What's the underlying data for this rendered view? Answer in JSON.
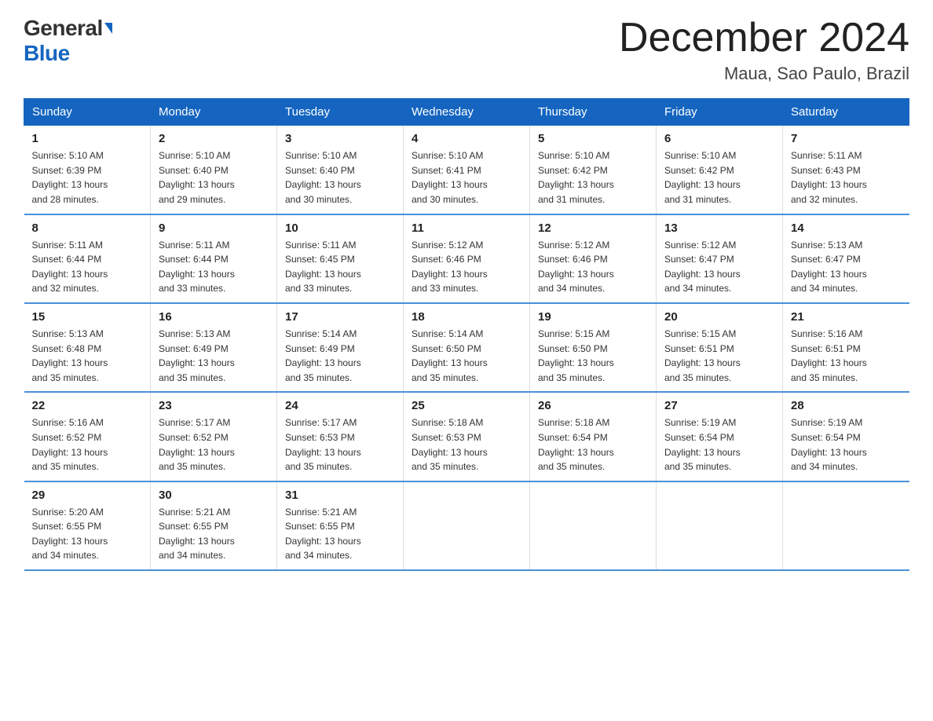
{
  "header": {
    "logo_general": "General",
    "logo_blue": "Blue",
    "month_title": "December 2024",
    "location": "Maua, Sao Paulo, Brazil"
  },
  "weekdays": [
    "Sunday",
    "Monday",
    "Tuesday",
    "Wednesday",
    "Thursday",
    "Friday",
    "Saturday"
  ],
  "weeks": [
    [
      {
        "day": "1",
        "sunrise": "5:10 AM",
        "sunset": "6:39 PM",
        "daylight": "13 hours and 28 minutes."
      },
      {
        "day": "2",
        "sunrise": "5:10 AM",
        "sunset": "6:40 PM",
        "daylight": "13 hours and 29 minutes."
      },
      {
        "day": "3",
        "sunrise": "5:10 AM",
        "sunset": "6:40 PM",
        "daylight": "13 hours and 30 minutes."
      },
      {
        "day": "4",
        "sunrise": "5:10 AM",
        "sunset": "6:41 PM",
        "daylight": "13 hours and 30 minutes."
      },
      {
        "day": "5",
        "sunrise": "5:10 AM",
        "sunset": "6:42 PM",
        "daylight": "13 hours and 31 minutes."
      },
      {
        "day": "6",
        "sunrise": "5:10 AM",
        "sunset": "6:42 PM",
        "daylight": "13 hours and 31 minutes."
      },
      {
        "day": "7",
        "sunrise": "5:11 AM",
        "sunset": "6:43 PM",
        "daylight": "13 hours and 32 minutes."
      }
    ],
    [
      {
        "day": "8",
        "sunrise": "5:11 AM",
        "sunset": "6:44 PM",
        "daylight": "13 hours and 32 minutes."
      },
      {
        "day": "9",
        "sunrise": "5:11 AM",
        "sunset": "6:44 PM",
        "daylight": "13 hours and 33 minutes."
      },
      {
        "day": "10",
        "sunrise": "5:11 AM",
        "sunset": "6:45 PM",
        "daylight": "13 hours and 33 minutes."
      },
      {
        "day": "11",
        "sunrise": "5:12 AM",
        "sunset": "6:46 PM",
        "daylight": "13 hours and 33 minutes."
      },
      {
        "day": "12",
        "sunrise": "5:12 AM",
        "sunset": "6:46 PM",
        "daylight": "13 hours and 34 minutes."
      },
      {
        "day": "13",
        "sunrise": "5:12 AM",
        "sunset": "6:47 PM",
        "daylight": "13 hours and 34 minutes."
      },
      {
        "day": "14",
        "sunrise": "5:13 AM",
        "sunset": "6:47 PM",
        "daylight": "13 hours and 34 minutes."
      }
    ],
    [
      {
        "day": "15",
        "sunrise": "5:13 AM",
        "sunset": "6:48 PM",
        "daylight": "13 hours and 35 minutes."
      },
      {
        "day": "16",
        "sunrise": "5:13 AM",
        "sunset": "6:49 PM",
        "daylight": "13 hours and 35 minutes."
      },
      {
        "day": "17",
        "sunrise": "5:14 AM",
        "sunset": "6:49 PM",
        "daylight": "13 hours and 35 minutes."
      },
      {
        "day": "18",
        "sunrise": "5:14 AM",
        "sunset": "6:50 PM",
        "daylight": "13 hours and 35 minutes."
      },
      {
        "day": "19",
        "sunrise": "5:15 AM",
        "sunset": "6:50 PM",
        "daylight": "13 hours and 35 minutes."
      },
      {
        "day": "20",
        "sunrise": "5:15 AM",
        "sunset": "6:51 PM",
        "daylight": "13 hours and 35 minutes."
      },
      {
        "day": "21",
        "sunrise": "5:16 AM",
        "sunset": "6:51 PM",
        "daylight": "13 hours and 35 minutes."
      }
    ],
    [
      {
        "day": "22",
        "sunrise": "5:16 AM",
        "sunset": "6:52 PM",
        "daylight": "13 hours and 35 minutes."
      },
      {
        "day": "23",
        "sunrise": "5:17 AM",
        "sunset": "6:52 PM",
        "daylight": "13 hours and 35 minutes."
      },
      {
        "day": "24",
        "sunrise": "5:17 AM",
        "sunset": "6:53 PM",
        "daylight": "13 hours and 35 minutes."
      },
      {
        "day": "25",
        "sunrise": "5:18 AM",
        "sunset": "6:53 PM",
        "daylight": "13 hours and 35 minutes."
      },
      {
        "day": "26",
        "sunrise": "5:18 AM",
        "sunset": "6:54 PM",
        "daylight": "13 hours and 35 minutes."
      },
      {
        "day": "27",
        "sunrise": "5:19 AM",
        "sunset": "6:54 PM",
        "daylight": "13 hours and 35 minutes."
      },
      {
        "day": "28",
        "sunrise": "5:19 AM",
        "sunset": "6:54 PM",
        "daylight": "13 hours and 34 minutes."
      }
    ],
    [
      {
        "day": "29",
        "sunrise": "5:20 AM",
        "sunset": "6:55 PM",
        "daylight": "13 hours and 34 minutes."
      },
      {
        "day": "30",
        "sunrise": "5:21 AM",
        "sunset": "6:55 PM",
        "daylight": "13 hours and 34 minutes."
      },
      {
        "day": "31",
        "sunrise": "5:21 AM",
        "sunset": "6:55 PM",
        "daylight": "13 hours and 34 minutes."
      },
      null,
      null,
      null,
      null
    ]
  ],
  "labels": {
    "sunrise": "Sunrise:",
    "sunset": "Sunset:",
    "daylight": "Daylight:"
  }
}
